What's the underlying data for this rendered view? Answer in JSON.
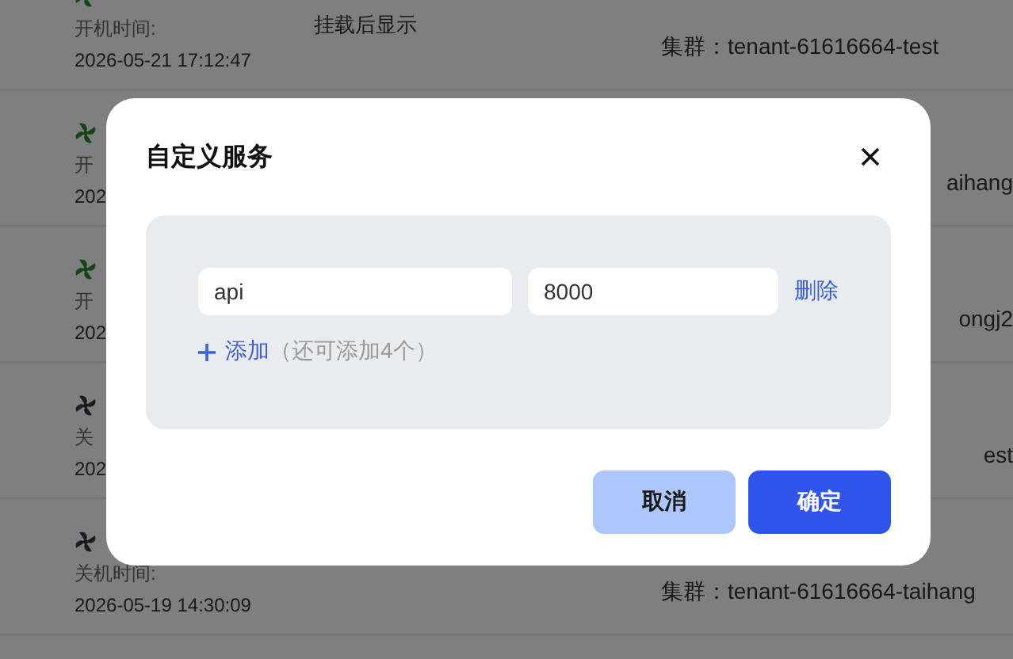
{
  "instances": [
    {
      "kind": "running",
      "time_label": "开机时间:",
      "time": "2026-05-21 17:12:47",
      "mount": "挂载后显示",
      "cluster": "集群：tenant-61616664-test"
    },
    {
      "kind": "running",
      "time_label": "开",
      "time": "202",
      "cluster": "aihang"
    },
    {
      "kind": "running",
      "time_label": "开",
      "time": "202",
      "cluster": "ongj2"
    },
    {
      "kind": "stopped",
      "time_label": "关",
      "time": "202",
      "cluster": "est"
    },
    {
      "kind": "stopped",
      "time_label": "关机时间:",
      "time": "2026-05-19 14:30:09",
      "cluster": "集群：tenant-61616664-taihang"
    }
  ],
  "dialog": {
    "title": "自定义服务",
    "services": [
      {
        "name": "api",
        "port": "8000",
        "remove": "删除"
      }
    ],
    "add_label": "添加",
    "add_hint": "（还可添加4个）",
    "buttons": [
      {
        "label": "取消",
        "kind": "secondary"
      },
      {
        "label": "确定",
        "kind": "primary"
      }
    ]
  }
}
